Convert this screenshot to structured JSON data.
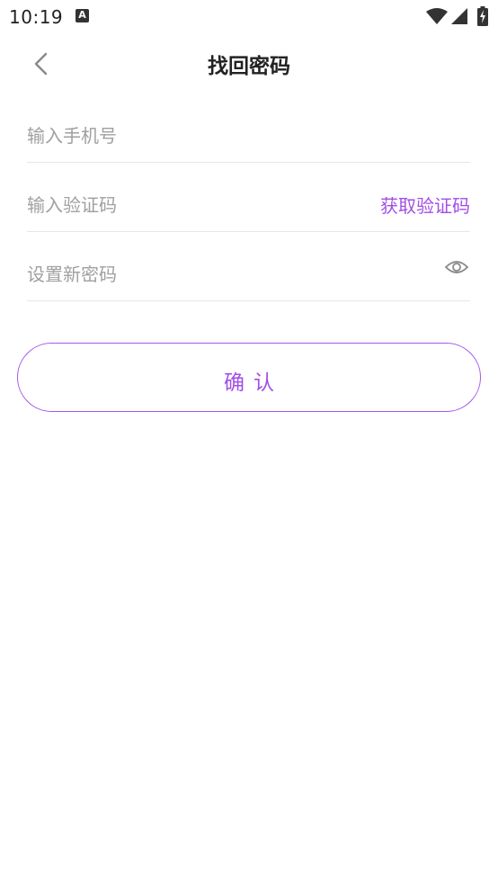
{
  "status_bar": {
    "time": "10:19",
    "notification_letter": "A"
  },
  "header": {
    "title": "找回密码",
    "back_icon": "chevron-left-icon"
  },
  "form": {
    "phone": {
      "value": "",
      "placeholder": "输入手机号"
    },
    "code": {
      "value": "",
      "placeholder": "输入验证码",
      "get_code_label": "获取验证码"
    },
    "password": {
      "value": "",
      "placeholder": "设置新密码",
      "toggle_icon": "eye-icon"
    }
  },
  "confirm": {
    "label": "确认"
  },
  "colors": {
    "accent": "#a24ee6",
    "title": "#222222",
    "placeholder": "#a0a0a0",
    "divider": "#e6e6e6",
    "background": "#ffffff"
  }
}
